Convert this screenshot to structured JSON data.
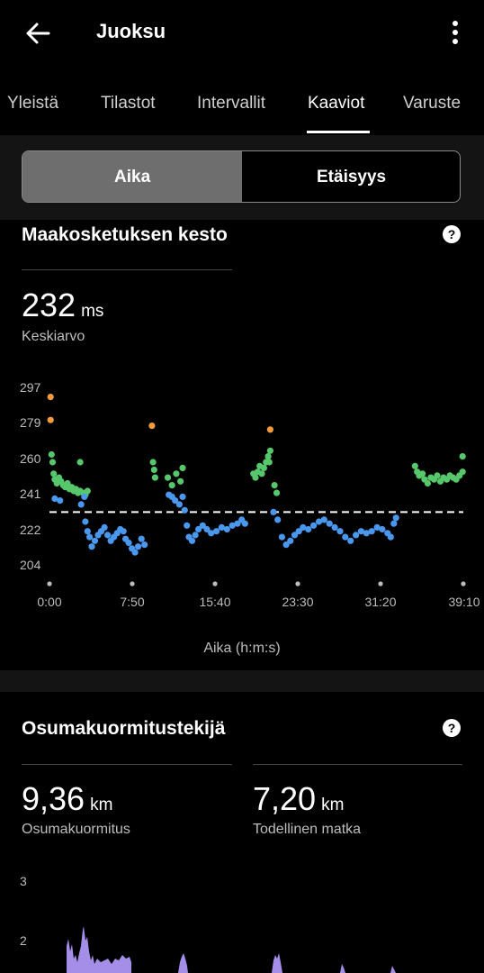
{
  "header": {
    "title": "Juoksu"
  },
  "tabs": [
    "Yleistä",
    "Tilastot",
    "Intervallit",
    "Kaaviot",
    "Varuste"
  ],
  "active_tab": "Kaaviot",
  "toggle": {
    "time": "Aika",
    "distance": "Etäisyys",
    "selected": "Aika"
  },
  "gct": {
    "title": "Maakosketuksen kesto",
    "help": "?",
    "value": "232",
    "unit": "ms",
    "value_label": "Keskiarvo",
    "xlabel": "Aika (h:m:s)"
  },
  "impact": {
    "title": "Osumakuormitustekijä",
    "help": "?",
    "load_value": "9,36",
    "load_unit": "km",
    "load_label": "Osumakuormitus",
    "dist_value": "7,20",
    "dist_unit": "km",
    "dist_label": "Todellinen matka",
    "yticks": [
      "3",
      "2"
    ]
  },
  "colors": {
    "blue": "#4a98ee",
    "green": "#57c76b",
    "orange": "#f39a3c",
    "purple": "#a58ee8"
  },
  "chart_data": [
    {
      "type": "scatter",
      "title": "Maakosketuksen kesto",
      "xlabel": "Aika (h:m:s)",
      "ylabel": "",
      "unit": "ms",
      "x_ticks": [
        "0:00",
        "7:50",
        "15:40",
        "23:30",
        "31:20",
        "39:10"
      ],
      "y_ticks": [
        204,
        222,
        241,
        260,
        279,
        297
      ],
      "ylim": [
        204,
        297
      ],
      "xlim_min": [
        0,
        39.17
      ],
      "average_ms": 232,
      "series": [
        {
          "color": "orange",
          "points": [
            [
              0.1,
              292
            ],
            [
              0.1,
              280
            ],
            [
              9.7,
              277
            ],
            [
              20.9,
              275
            ]
          ]
        },
        {
          "color": "green",
          "points": [
            [
              0.2,
              262
            ],
            [
              0.3,
              258
            ],
            [
              0.4,
              252
            ],
            [
              0.5,
              249
            ],
            [
              0.7,
              247
            ],
            [
              0.9,
              250
            ],
            [
              1.1,
              248
            ],
            [
              1.3,
              246
            ],
            [
              1.5,
              245
            ],
            [
              1.7,
              247
            ],
            [
              1.9,
              244
            ],
            [
              2.1,
              245
            ],
            [
              2.3,
              243
            ],
            [
              2.5,
              244
            ],
            [
              2.7,
              242
            ],
            [
              2.9,
              243
            ],
            [
              3.2,
              242
            ],
            [
              3.4,
              241
            ],
            [
              3.6,
              243
            ],
            [
              2.9,
              258
            ],
            [
              9.8,
              258
            ],
            [
              9.9,
              254
            ],
            [
              10.0,
              250
            ],
            [
              11.2,
              250
            ],
            [
              11.6,
              246
            ],
            [
              12.0,
              252
            ],
            [
              12.4,
              248
            ],
            [
              12.6,
              255
            ],
            [
              19.3,
              252
            ],
            [
              19.5,
              250
            ],
            [
              19.7,
              253
            ],
            [
              19.9,
              256
            ],
            [
              20.1,
              252
            ],
            [
              20.3,
              255
            ],
            [
              20.5,
              258
            ],
            [
              20.7,
              261
            ],
            [
              20.9,
              264
            ],
            [
              20.8,
              258
            ],
            [
              21.3,
              246
            ],
            [
              21.5,
              242
            ],
            [
              34.6,
              256
            ],
            [
              34.8,
              253
            ],
            [
              35.0,
              251
            ],
            [
              35.3,
              252
            ],
            [
              35.5,
              249
            ],
            [
              35.8,
              247
            ],
            [
              36.1,
              250
            ],
            [
              36.4,
              249
            ],
            [
              36.7,
              251
            ],
            [
              37.0,
              248
            ],
            [
              37.3,
              250
            ],
            [
              37.6,
              249
            ],
            [
              37.9,
              251
            ],
            [
              38.2,
              250
            ],
            [
              38.5,
              249
            ],
            [
              38.8,
              251
            ],
            [
              39.1,
              253
            ],
            [
              39.1,
              261
            ]
          ]
        },
        {
          "color": "blue",
          "points": [
            [
              0.5,
              239
            ],
            [
              1.0,
              238
            ],
            [
              3.0,
              236
            ],
            [
              3.3,
              240
            ],
            [
              3.4,
              227
            ],
            [
              3.6,
              222
            ],
            [
              3.8,
              219
            ],
            [
              4.0,
              214
            ],
            [
              4.3,
              217
            ],
            [
              4.6,
              220
            ],
            [
              4.9,
              222
            ],
            [
              5.2,
              224
            ],
            [
              5.5,
              220
            ],
            [
              5.8,
              217
            ],
            [
              6.1,
              219
            ],
            [
              6.4,
              221
            ],
            [
              6.7,
              223
            ],
            [
              7.0,
              222
            ],
            [
              7.2,
              218
            ],
            [
              7.5,
              216
            ],
            [
              7.8,
              213
            ],
            [
              8.1,
              211
            ],
            [
              8.4,
              214
            ],
            [
              8.7,
              218
            ],
            [
              9.0,
              215
            ],
            [
              11.3,
              241
            ],
            [
              11.6,
              240
            ],
            [
              11.9,
              238
            ],
            [
              12.3,
              236
            ],
            [
              12.6,
              240
            ],
            [
              12.8,
              233
            ],
            [
              13.0,
              225
            ],
            [
              13.2,
              219
            ],
            [
              13.5,
              217
            ],
            [
              13.8,
              220
            ],
            [
              14.1,
              223
            ],
            [
              14.5,
              225
            ],
            [
              14.9,
              223
            ],
            [
              15.3,
              221
            ],
            [
              15.8,
              222
            ],
            [
              16.3,
              224
            ],
            [
              16.8,
              223
            ],
            [
              17.3,
              225
            ],
            [
              17.8,
              226
            ],
            [
              18.2,
              228
            ],
            [
              18.5,
              226
            ],
            [
              21.2,
              232
            ],
            [
              21.6,
              228
            ],
            [
              22.0,
              219
            ],
            [
              22.4,
              215
            ],
            [
              22.8,
              217
            ],
            [
              23.2,
              220
            ],
            [
              23.6,
              222
            ],
            [
              24.0,
              224
            ],
            [
              24.5,
              223
            ],
            [
              25.0,
              225
            ],
            [
              25.5,
              227
            ],
            [
              26.0,
              228
            ],
            [
              26.5,
              226
            ],
            [
              27.0,
              224
            ],
            [
              27.5,
              222
            ],
            [
              28.0,
              219
            ],
            [
              28.5,
              217
            ],
            [
              29.0,
              220
            ],
            [
              29.5,
              222
            ],
            [
              30.0,
              221
            ],
            [
              30.5,
              222
            ],
            [
              31.0,
              224
            ],
            [
              31.5,
              223
            ],
            [
              32.0,
              221
            ],
            [
              32.3,
              219
            ],
            [
              32.6,
              226
            ],
            [
              32.8,
              229
            ]
          ]
        }
      ]
    },
    {
      "type": "area",
      "title": "Osumakuormitustekijä",
      "y_ticks": [
        3,
        2
      ],
      "series": [
        {
          "color": "purple",
          "note": "partially visible (cut off at bottom)"
        }
      ]
    }
  ]
}
